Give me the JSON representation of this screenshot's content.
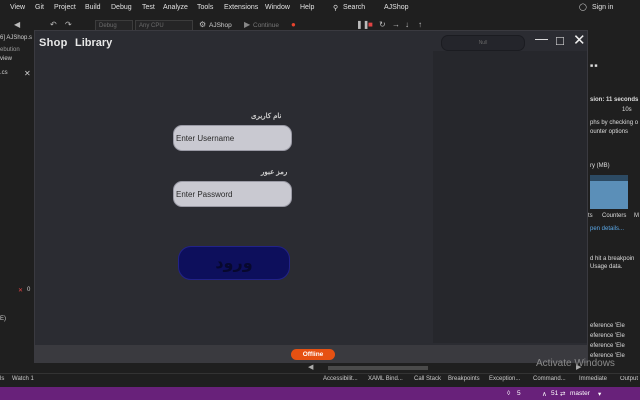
{
  "menu": [
    "View",
    "Git",
    "Project",
    "Build",
    "Debug",
    "Test",
    "Analyze",
    "Tools",
    "Extensions",
    "Window",
    "Help"
  ],
  "search_label": "Search",
  "solution_name": "AJShop",
  "signin_label": "Sign in",
  "toolbar": {
    "config": "Debug",
    "platform": "Any CPU",
    "startup_project": "AJShop",
    "continue_label": "Continue"
  },
  "left_pane": {
    "doc_tab": "6] AJShop.s",
    "line1": "ebution",
    "line2": "view",
    "file_tab": ".cs",
    "error_count": "0",
    "lower_item": "E)"
  },
  "app": {
    "title_left": "Shop",
    "title_right": "Library",
    "debug_pill_text": "Null",
    "username_label": "نام کاربری",
    "username_placeholder": "Enter Username",
    "password_label": "رمز عبور",
    "password_placeholder": "Enter Password",
    "login_button": "ورود",
    "status_badge": "Offline",
    "status_color": "#e65112"
  },
  "right_pane": {
    "session_line": "sion: 11 seconds",
    "time_label": "10s",
    "hint_line1": "phs by checking o",
    "hint_line2": "ounter options",
    "memory_label": "ry (MB)",
    "tab_events": "ts",
    "tab_counters": "Counters",
    "tab_m": "M",
    "open_details": "pen details...",
    "breakpoint_line": "d hit a breakpoin",
    "usage_line": "Usage data.",
    "reference_lines": [
      "eference 'Ele",
      "eference 'Ele",
      "eference 'Ele",
      "eference 'Ele"
    ]
  },
  "bottom_tabs": [
    "ls",
    "Watch 1",
    "Accessibilit...",
    "XAML Bind...",
    "Call Stack",
    "Breakpoints",
    "Exception...",
    "Command...",
    "Immediate",
    "Output"
  ],
  "watermark": "Activate Windows",
  "statusbar": {
    "errors": "5",
    "warnings": "51",
    "branch": "master"
  }
}
